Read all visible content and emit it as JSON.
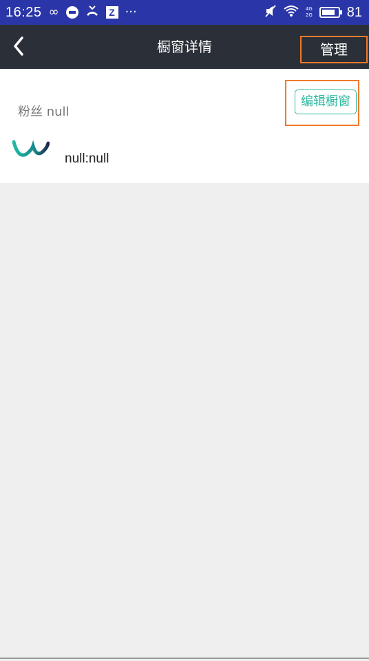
{
  "status_bar": {
    "time": "16:25",
    "icons": [
      "infinity-icon",
      "sync-icon",
      "missed-call-icon",
      "z-app-icon",
      "more-dots-icon",
      "mute-icon",
      "wifi-icon",
      "signal-icon"
    ],
    "network_4g": "4G",
    "network_2g": "2G",
    "battery_level": "81",
    "battery_fraction": 0.81,
    "background": "#2a36a8"
  },
  "nav": {
    "title": "橱窗详情",
    "manage_label": "管理",
    "background": "#2b2f37"
  },
  "profile": {
    "fans_label": "粉丝 null",
    "edit_button": "编辑橱窗",
    "shop_line": "null:null"
  },
  "colors": {
    "accent": "#2ab7a0",
    "highlight_box": "#f07a2a",
    "page_bg": "#efefef"
  }
}
